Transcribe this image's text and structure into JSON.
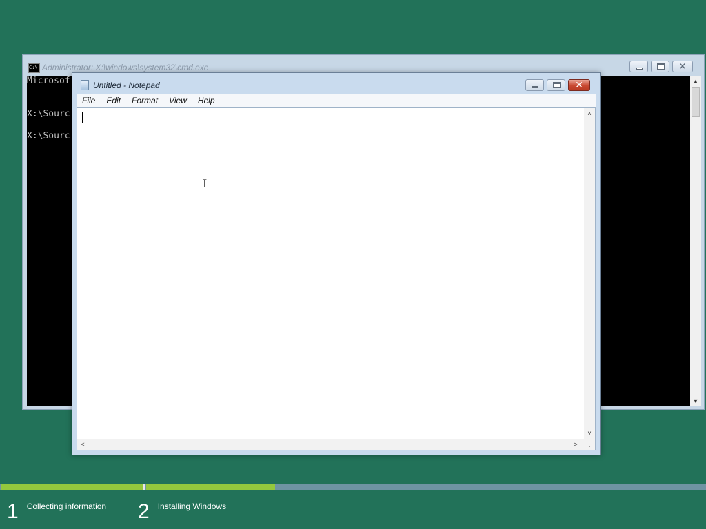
{
  "cmd": {
    "title": "Administrator: X:\\windows\\system32\\cmd.exe",
    "icon": "cmd-icon",
    "lines": [
      "Microsof",
      "X:\\Sourc",
      "X:\\Sourc"
    ]
  },
  "notepad": {
    "title": "Untitled - Notepad",
    "menu": [
      "File",
      "Edit",
      "Format",
      "View",
      "Help"
    ],
    "content": ""
  },
  "setup": {
    "steps": [
      {
        "number": "1",
        "label": "Collecting information"
      },
      {
        "number": "2",
        "label": "Installing Windows"
      }
    ],
    "progress": [
      1.0,
      0.23
    ],
    "colors": {
      "fill": "#94c83d",
      "track": "#6f94a3",
      "background": "#227259"
    }
  }
}
